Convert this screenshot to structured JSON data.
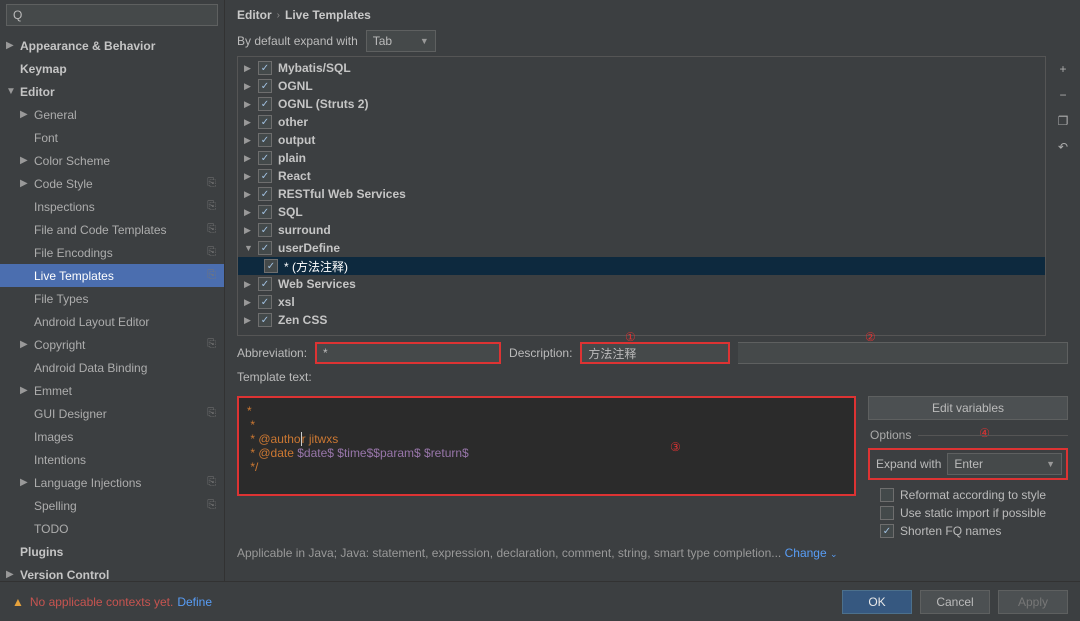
{
  "search_placeholder": "",
  "search_prefix": "Q",
  "breadcrumb": {
    "parent": "Editor",
    "current": "Live Templates"
  },
  "sidebar": [
    {
      "label": "Appearance & Behavior",
      "depth": 0,
      "arrow": "▶",
      "bold": true
    },
    {
      "label": "Keymap",
      "depth": 0,
      "arrow": "",
      "bold": true
    },
    {
      "label": "Editor",
      "depth": 0,
      "arrow": "▼",
      "bold": true
    },
    {
      "label": "General",
      "depth": 1,
      "arrow": "▶"
    },
    {
      "label": "Font",
      "depth": 1,
      "arrow": ""
    },
    {
      "label": "Color Scheme",
      "depth": 1,
      "arrow": "▶"
    },
    {
      "label": "Code Style",
      "depth": 1,
      "arrow": "▶",
      "copy": true
    },
    {
      "label": "Inspections",
      "depth": 1,
      "arrow": "",
      "copy": true
    },
    {
      "label": "File and Code Templates",
      "depth": 1,
      "arrow": "",
      "copy": true
    },
    {
      "label": "File Encodings",
      "depth": 1,
      "arrow": "",
      "copy": true
    },
    {
      "label": "Live Templates",
      "depth": 1,
      "arrow": "",
      "copy": true,
      "selected": true
    },
    {
      "label": "File Types",
      "depth": 1,
      "arrow": ""
    },
    {
      "label": "Android Layout Editor",
      "depth": 1,
      "arrow": ""
    },
    {
      "label": "Copyright",
      "depth": 1,
      "arrow": "▶",
      "copy": true
    },
    {
      "label": "Android Data Binding",
      "depth": 1,
      "arrow": ""
    },
    {
      "label": "Emmet",
      "depth": 1,
      "arrow": "▶"
    },
    {
      "label": "GUI Designer",
      "depth": 1,
      "arrow": "",
      "copy": true
    },
    {
      "label": "Images",
      "depth": 1,
      "arrow": ""
    },
    {
      "label": "Intentions",
      "depth": 1,
      "arrow": ""
    },
    {
      "label": "Language Injections",
      "depth": 1,
      "arrow": "▶",
      "copy": true
    },
    {
      "label": "Spelling",
      "depth": 1,
      "arrow": "",
      "copy": true
    },
    {
      "label": "TODO",
      "depth": 1,
      "arrow": ""
    },
    {
      "label": "Plugins",
      "depth": 0,
      "arrow": "",
      "bold": true
    },
    {
      "label": "Version Control",
      "depth": 0,
      "arrow": "▶",
      "bold": true
    }
  ],
  "default_expand": {
    "label": "By default expand with",
    "value": "Tab"
  },
  "groups": [
    {
      "label": "Mybatis/SQL",
      "arrow": "▶",
      "checked": true
    },
    {
      "label": "OGNL",
      "arrow": "▶",
      "checked": true
    },
    {
      "label": "OGNL (Struts 2)",
      "arrow": "▶",
      "checked": true
    },
    {
      "label": "other",
      "arrow": "▶",
      "checked": true
    },
    {
      "label": "output",
      "arrow": "▶",
      "checked": true
    },
    {
      "label": "plain",
      "arrow": "▶",
      "checked": true
    },
    {
      "label": "React",
      "arrow": "▶",
      "checked": true
    },
    {
      "label": "RESTful Web Services",
      "arrow": "▶",
      "checked": true
    },
    {
      "label": "SQL",
      "arrow": "▶",
      "checked": true
    },
    {
      "label": "surround",
      "arrow": "▶",
      "checked": true
    },
    {
      "label": "userDefine",
      "arrow": "▼",
      "checked": true
    },
    {
      "label": "* (方法注释)",
      "arrow": "",
      "checked": true,
      "child": true,
      "selected": true
    },
    {
      "label": "Web Services",
      "arrow": "▶",
      "checked": true
    },
    {
      "label": "xsl",
      "arrow": "▶",
      "checked": true
    },
    {
      "label": "Zen CSS",
      "arrow": "▶",
      "checked": true
    }
  ],
  "vtoolbar": {
    "add": "+",
    "remove": "−",
    "duplicate": "❐",
    "revert": "↶"
  },
  "form": {
    "abbr_label": "Abbreviation:",
    "abbr_value": "*",
    "desc_label": "Description:",
    "desc_value": "方法注释",
    "tmpl_label": "Template text:"
  },
  "template_lines": [
    {
      "t": "*"
    },
    {
      "t": " *"
    },
    {
      "t": " * @author jitwxs",
      "caret_after": "@autho"
    },
    {
      "t": " * @date $date$ $time$$param$ $return$",
      "vars": [
        "$date$",
        "$time$",
        "$param$",
        "$return$"
      ]
    },
    {
      "t": " */"
    }
  ],
  "annotations": {
    "one": "①",
    "two": "②",
    "three": "③",
    "four": "④"
  },
  "edit_vars": "Edit variables",
  "options": {
    "title": "Options",
    "expand_label": "Expand with",
    "expand_value": "Enter",
    "reformat": {
      "label": "Reformat according to style",
      "checked": false
    },
    "static": {
      "label": "Use static import if possible",
      "checked": false
    },
    "shorten": {
      "label": "Shorten FQ names",
      "checked": true
    }
  },
  "applicable": {
    "text": "Applicable in Java; Java: statement, expression, declaration, comment, string, smart type completion...",
    "link": "Change"
  },
  "footer": {
    "warn": "No applicable contexts yet.",
    "define": "Define",
    "ok": "OK",
    "cancel": "Cancel",
    "apply": "Apply"
  }
}
